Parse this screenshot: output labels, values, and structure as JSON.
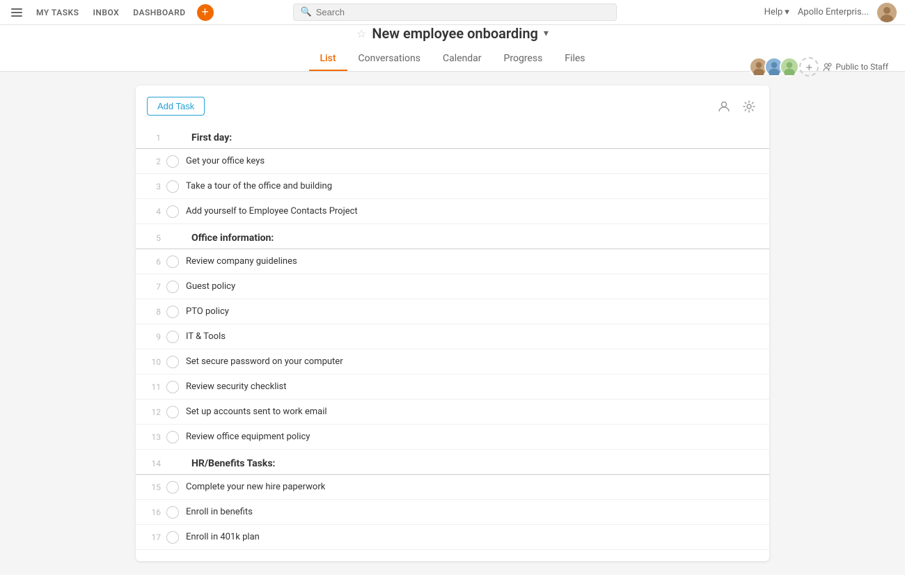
{
  "nav": {
    "hamburger_label": "menu",
    "links": [
      "MY TASKS",
      "INBOX",
      "DASHBOARD"
    ],
    "add_btn_label": "+",
    "search_placeholder": "Search",
    "help_label": "Help",
    "company_label": "Apollo Enterpris...",
    "avatar_alt": "user avatar"
  },
  "project": {
    "title": "New employee onboarding",
    "tabs": [
      "List",
      "Conversations",
      "Calendar",
      "Progress",
      "Files"
    ],
    "active_tab": "List",
    "privacy": "Public to Staff"
  },
  "toolbar": {
    "add_task_label": "Add Task"
  },
  "sections": [
    {
      "id": 1,
      "row_num": "1",
      "type": "section",
      "title": "First day:"
    },
    {
      "id": 2,
      "row_num": "2",
      "type": "task",
      "name": "Get your office keys"
    },
    {
      "id": 3,
      "row_num": "3",
      "type": "task",
      "name": "Take a tour of the office and building"
    },
    {
      "id": 4,
      "row_num": "4",
      "type": "task",
      "name": "Add yourself to Employee Contacts Project"
    },
    {
      "id": 5,
      "row_num": "5",
      "type": "section",
      "title": "Office information:"
    },
    {
      "id": 6,
      "row_num": "6",
      "type": "task",
      "name": "Review company guidelines"
    },
    {
      "id": 7,
      "row_num": "7",
      "type": "task",
      "name": "Guest policy"
    },
    {
      "id": 8,
      "row_num": "8",
      "type": "task",
      "name": "PTO policy"
    },
    {
      "id": 9,
      "row_num": "9",
      "type": "task",
      "name": "IT & Tools"
    },
    {
      "id": 10,
      "row_num": "10",
      "type": "task",
      "name": "Set secure password on your computer"
    },
    {
      "id": 11,
      "row_num": "11",
      "type": "task",
      "name": "Review security checklist"
    },
    {
      "id": 12,
      "row_num": "12",
      "type": "task",
      "name": "Set up accounts sent to work email"
    },
    {
      "id": 13,
      "row_num": "13",
      "type": "task",
      "name": "Review office equipment policy"
    },
    {
      "id": 14,
      "row_num": "14",
      "type": "section",
      "title": "HR/Benefits Tasks:"
    },
    {
      "id": 15,
      "row_num": "15",
      "type": "task",
      "name": "Complete your new hire paperwork"
    },
    {
      "id": 16,
      "row_num": "16",
      "type": "task",
      "name": "Enroll in benefits"
    },
    {
      "id": 17,
      "row_num": "17",
      "type": "task",
      "name": "Enroll in 401k plan"
    }
  ]
}
